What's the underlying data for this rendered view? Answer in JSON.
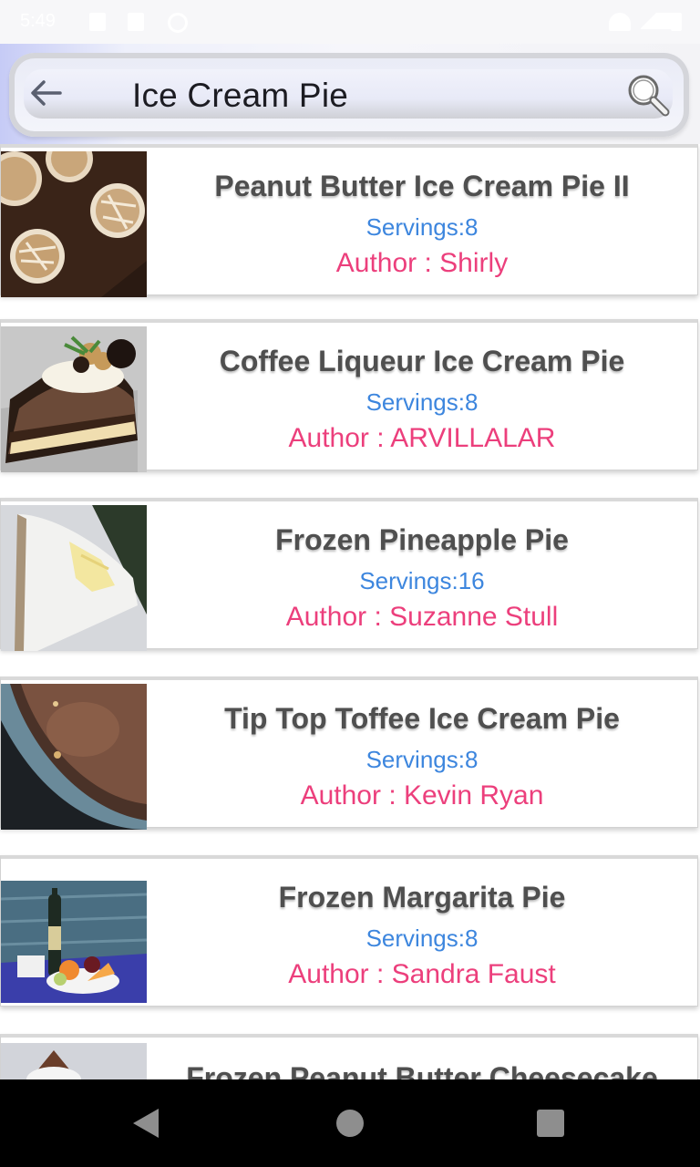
{
  "status_bar": {
    "time": "5:49"
  },
  "search": {
    "query": "Ice Cream Pie",
    "back_icon": "arrow-left-icon",
    "search_icon": "magnifier-icon"
  },
  "colors": {
    "title": "#4f4f4f",
    "servings": "#3d86de",
    "author": "#ec3f7c",
    "nav_bar": "#000000"
  },
  "recipes": [
    {
      "title": "Peanut Butter Ice Cream Pie II",
      "servings": "Servings:8",
      "author": "Author : Shirly",
      "image": "peanut-butter-pie-photo"
    },
    {
      "title": "Coffee Liqueur Ice Cream Pie",
      "servings": "Servings:8",
      "author": "Author : ARVILLALAR",
      "image": "coffee-pie-photo"
    },
    {
      "title": "Frozen Pineapple Pie",
      "servings": "Servings:16",
      "author": "Author : Suzanne Stull",
      "image": "pineapple-pie-photo"
    },
    {
      "title": "Tip Top Toffee Ice Cream Pie",
      "servings": "Servings:8",
      "author": "Author : Kevin Ryan",
      "image": "toffee-pie-photo"
    },
    {
      "title": "Frozen Margarita Pie",
      "servings": "Servings:8",
      "author": "Author : Sandra Faust",
      "image": "margarita-pie-photo"
    },
    {
      "title": "Frozen Peanut Butter Cheesecake",
      "servings": "",
      "author": "",
      "image": "cheesecake-photo"
    }
  ],
  "nav": {
    "back": "nav-back-icon",
    "home": "nav-home-icon",
    "recents": "nav-recents-icon"
  }
}
